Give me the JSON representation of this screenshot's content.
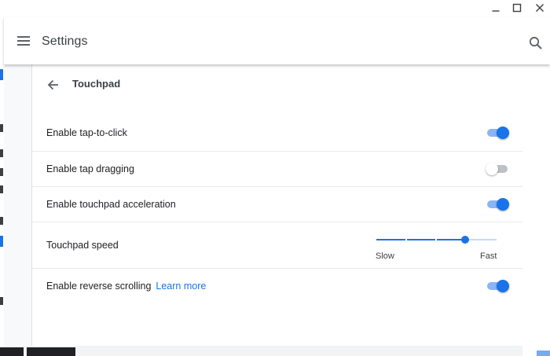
{
  "app": {
    "title": "Settings"
  },
  "page": {
    "title": "Touchpad"
  },
  "settings": [
    {
      "label": "Enable tap-to-click",
      "type": "toggle",
      "on": true
    },
    {
      "label": "Enable tap dragging",
      "type": "toggle",
      "on": false
    },
    {
      "label": "Enable touchpad acceleration",
      "type": "toggle",
      "on": true
    },
    {
      "label": "Touchpad speed",
      "type": "slider",
      "value": 4,
      "min": 1,
      "max": 5,
      "min_label": "Slow",
      "max_label": "Fast"
    },
    {
      "label": "Enable reverse scrolling",
      "link": "Learn more",
      "type": "toggle",
      "on": true
    }
  ],
  "icons": {
    "menu": "hamburger-menu-icon",
    "search": "search-icon",
    "back": "back-arrow-icon",
    "minimize": "minimize-icon",
    "maximize": "maximize-icon",
    "close": "close-icon"
  },
  "colors": {
    "accent": "#1a73e8",
    "accent_light": "#8ab4f8",
    "link": "#1a73e8"
  }
}
